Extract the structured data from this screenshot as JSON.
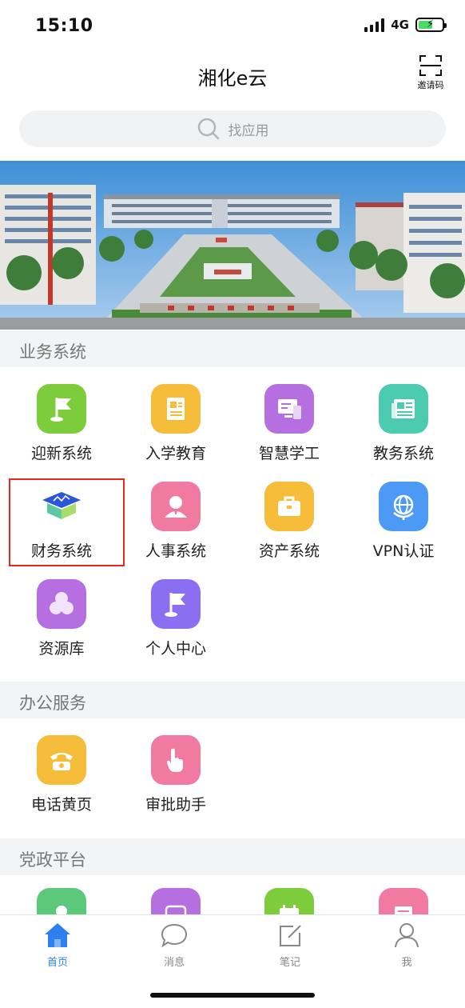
{
  "status_bar": {
    "time": "15:10",
    "network": "4G"
  },
  "header": {
    "title": "湘化e云",
    "scan_label": "邀请码"
  },
  "search": {
    "placeholder": "找应用"
  },
  "sections": {
    "business": {
      "title": "业务系统",
      "apps": [
        {
          "label": "迎新系统",
          "icon": "flag-icon",
          "color": "#7dcc3c"
        },
        {
          "label": "入学教育",
          "icon": "document-icon",
          "color": "#f5bd3a"
        },
        {
          "label": "智慧学工",
          "icon": "computer-phone-icon",
          "color": "#b56fe0"
        },
        {
          "label": "教务系统",
          "icon": "newspaper-icon",
          "color": "#4ccbb0"
        },
        {
          "label": "财务系统",
          "icon": "graduation-cap-icon",
          "color": "#ffffff"
        },
        {
          "label": "人事系统",
          "icon": "person-icon",
          "color": "#f07aa0"
        },
        {
          "label": "资产系统",
          "icon": "briefcase-icon",
          "color": "#f5bd3a"
        },
        {
          "label": "VPN认证",
          "icon": "globe-icon",
          "color": "#4c9af5"
        },
        {
          "label": "资源库",
          "icon": "circles-icon",
          "color": "#b56fe0"
        },
        {
          "label": "个人中心",
          "icon": "flag-icon",
          "color": "#8c6ff0"
        }
      ]
    },
    "office": {
      "title": "办公服务",
      "apps": [
        {
          "label": "电话黄页",
          "icon": "telephone-icon",
          "color": "#f5bd3a"
        },
        {
          "label": "审批助手",
          "icon": "hand-pointer-icon",
          "color": "#f07aa0"
        }
      ]
    },
    "party": {
      "title": "党政平台",
      "apps": [
        {
          "icon": "pin-icon",
          "color": "#5cc87a"
        },
        {
          "icon": "chat-icon",
          "color": "#b56fe0"
        },
        {
          "icon": "calendar-icon",
          "color": "#7dcc3c"
        },
        {
          "icon": "list-icon",
          "color": "#f07aa0"
        }
      ]
    }
  },
  "tabs": [
    {
      "label": "首页",
      "icon": "home-icon",
      "active": true
    },
    {
      "label": "消息",
      "icon": "message-icon",
      "active": false
    },
    {
      "label": "笔记",
      "icon": "edit-icon",
      "active": false
    },
    {
      "label": "我",
      "icon": "profile-icon",
      "active": false
    }
  ],
  "colors": {
    "accent": "#2f7ff0",
    "highlight": "#e5291c"
  }
}
